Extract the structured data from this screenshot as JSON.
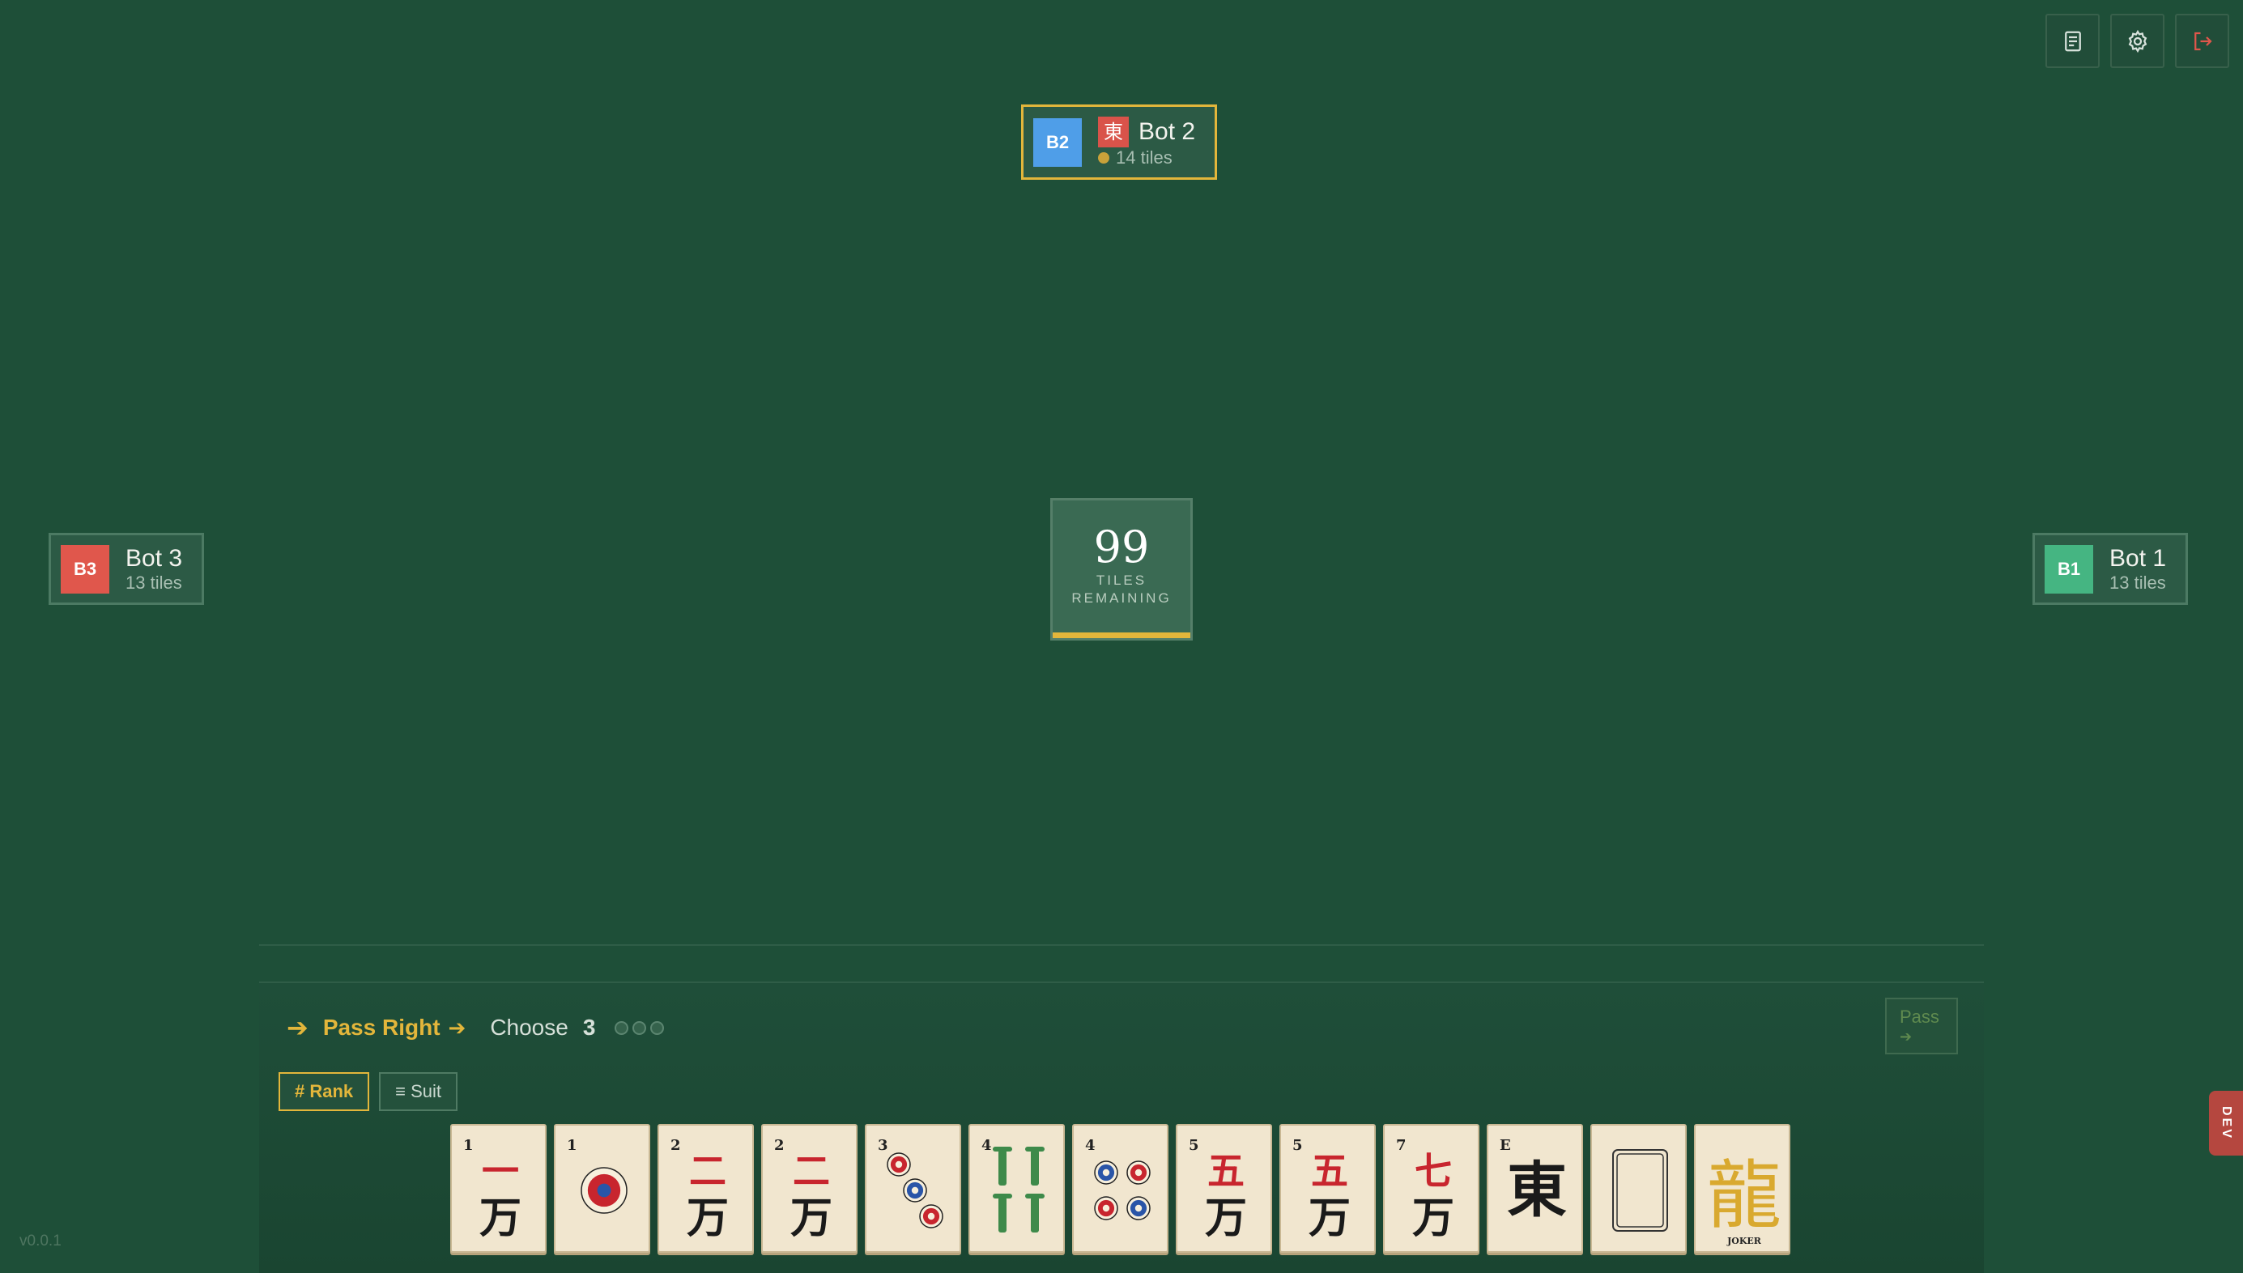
{
  "toolbar": {
    "icons": [
      "log-icon",
      "settings-icon",
      "exit-icon"
    ],
    "exit_color": "#e0564b"
  },
  "players": {
    "top": {
      "avatar": "B2",
      "avatar_color": "#4f9ee8",
      "wind": "東",
      "name": "Bot 2",
      "tiles": "14 tiles",
      "active": true
    },
    "left": {
      "avatar": "B3",
      "avatar_color": "#e0574c",
      "name": "Bot 3",
      "tiles": "13 tiles"
    },
    "right": {
      "avatar": "B1",
      "avatar_color": "#45b582",
      "name": "Bot 1",
      "tiles": "13 tiles"
    }
  },
  "wall": {
    "count": "99",
    "label_line1": "TILES",
    "label_line2": "REMAINING",
    "progress": 1.0,
    "accent": "#e3b63b"
  },
  "pass": {
    "arrow": "➔",
    "title": "Pass Right",
    "title_arrow": "➔",
    "choose_label": "Choose",
    "choose_count": "3",
    "selected": 0,
    "button_label": "Pass",
    "button_arrow": "➔"
  },
  "sort": {
    "rank_label": "# Rank",
    "suit_label": "≡ Suit",
    "active": "rank"
  },
  "hand": [
    {
      "kind": "crak",
      "num": "1",
      "glyph": "一"
    },
    {
      "kind": "dot",
      "num": "1",
      "count": 1
    },
    {
      "kind": "crak",
      "num": "2",
      "glyph": "二"
    },
    {
      "kind": "crak",
      "num": "2",
      "glyph": "二"
    },
    {
      "kind": "dot",
      "num": "3",
      "count": 3
    },
    {
      "kind": "bam",
      "num": "4",
      "count": 4
    },
    {
      "kind": "dot",
      "num": "4",
      "count": 4
    },
    {
      "kind": "crak",
      "num": "5",
      "glyph": "五"
    },
    {
      "kind": "crak",
      "num": "5",
      "glyph": "五"
    },
    {
      "kind": "crak",
      "num": "7",
      "glyph": "七"
    },
    {
      "kind": "wind",
      "num": "E",
      "glyph": "東"
    },
    {
      "kind": "blank"
    },
    {
      "kind": "joker",
      "glyph": "龍",
      "label": "JOKER"
    }
  ],
  "version": "v0.0.1",
  "dev_tab": "DEV"
}
